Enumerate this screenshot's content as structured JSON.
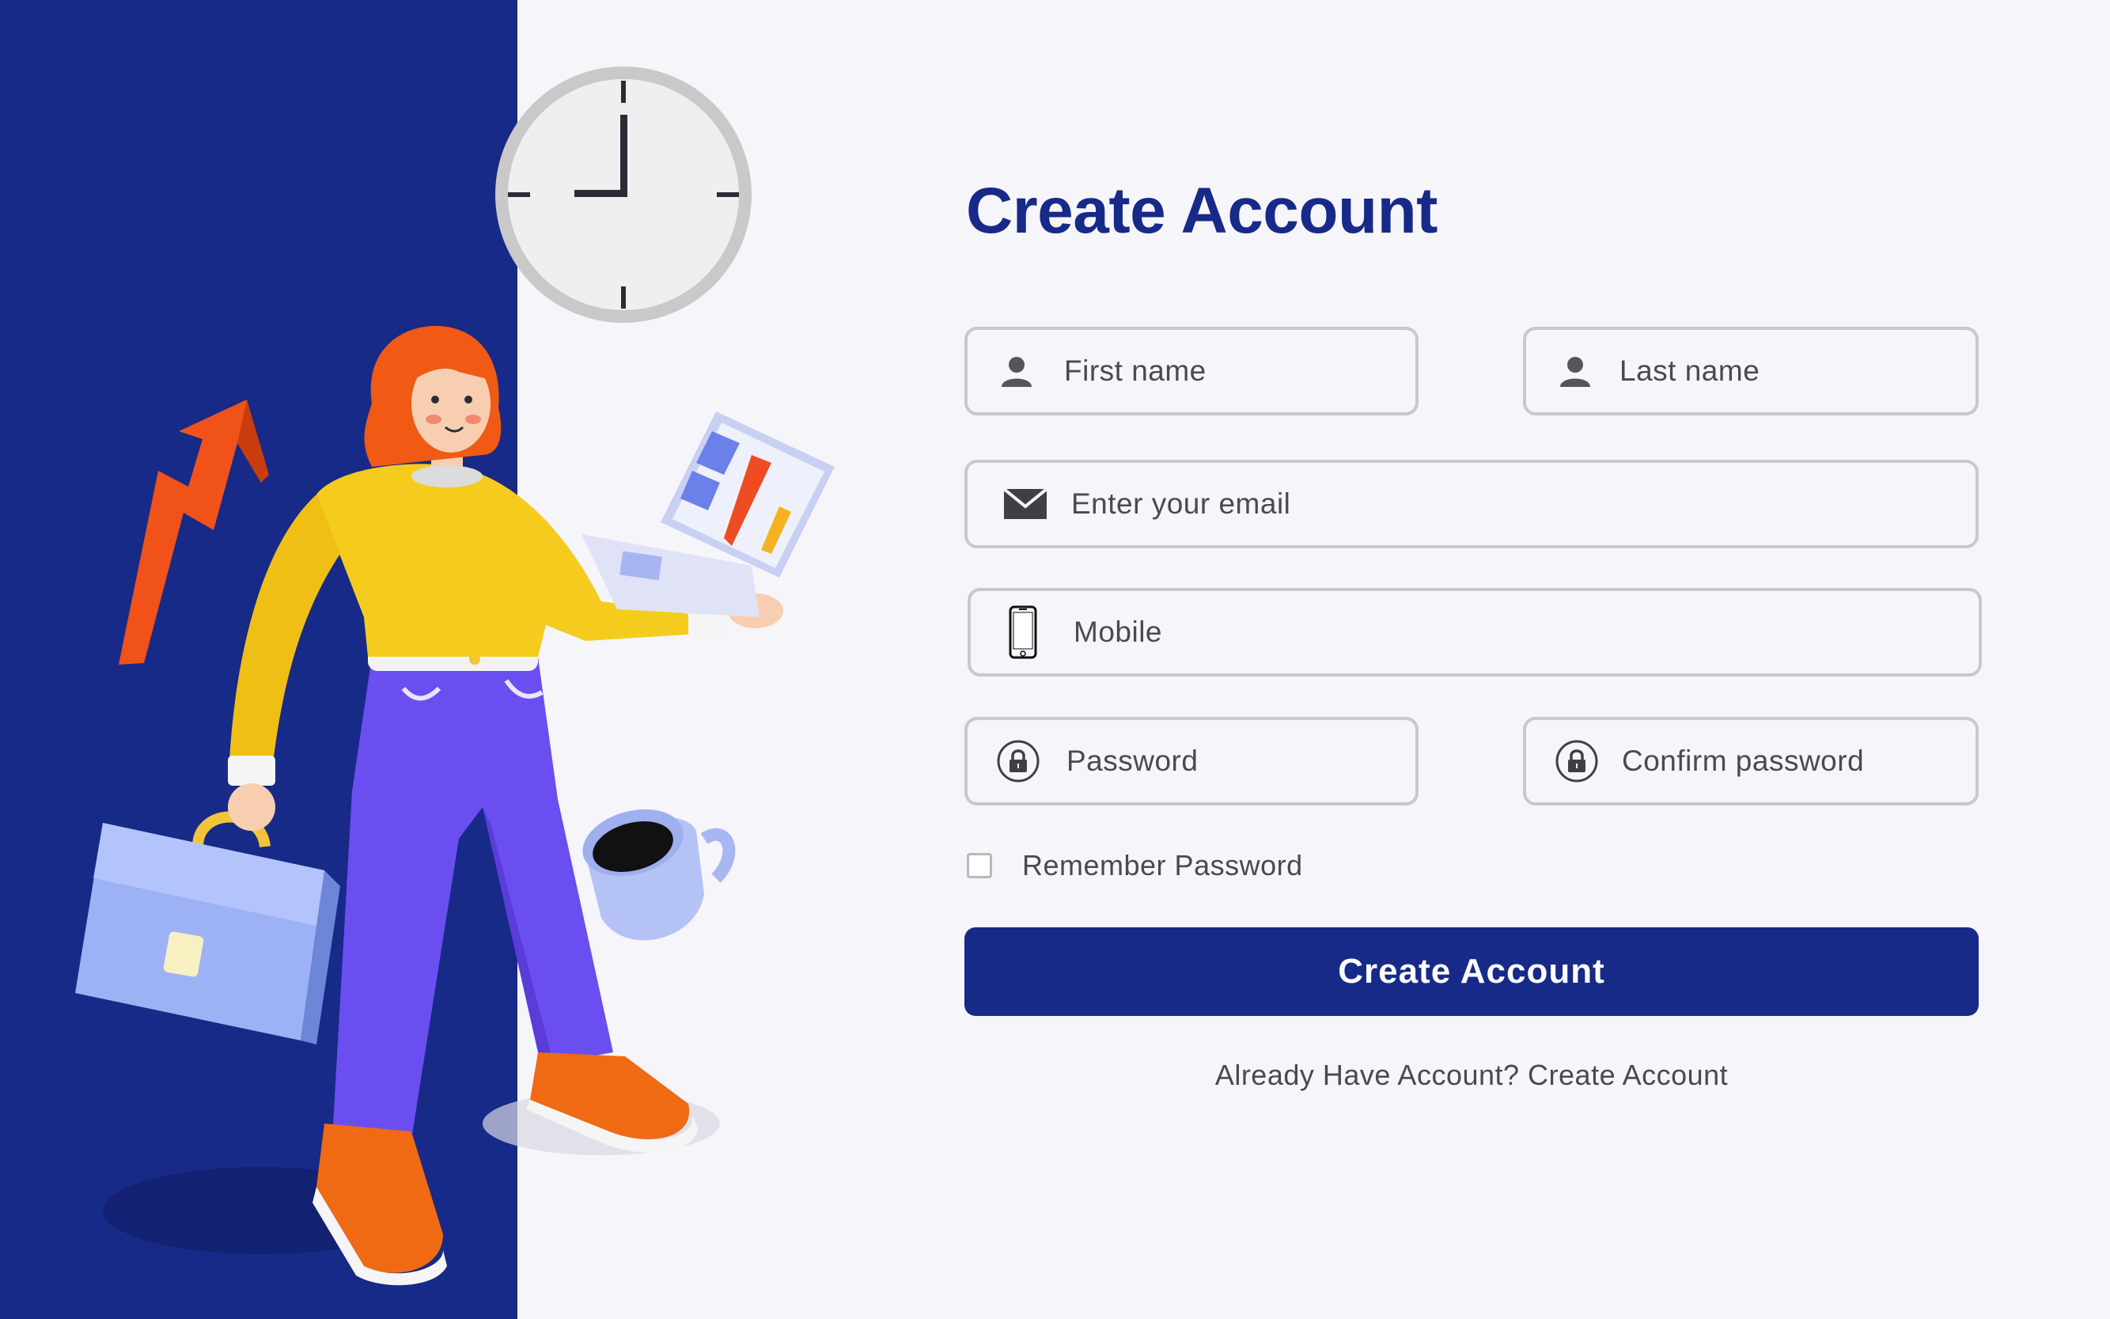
{
  "form": {
    "title": "Create Account",
    "first_name_placeholder": "First name",
    "last_name_placeholder": "Last name",
    "email_placeholder": "Enter your email",
    "mobile_placeholder": "Mobile",
    "password_placeholder": "Password",
    "confirm_password_placeholder": "Confirm password",
    "remember_label": "Remember Password",
    "remember_checked": false,
    "submit_label": "Create Account",
    "footer_text": "Already Have Account? Create Account"
  },
  "icons": {
    "first_name": "user-icon",
    "last_name": "user-icon",
    "email": "mail-icon",
    "mobile": "phone-icon",
    "password": "lock-icon",
    "confirm_password": "lock-icon"
  },
  "colors": {
    "brand": "#172a88",
    "background": "#f6f5fa",
    "field_border": "#c9c9cd",
    "text": "#4a4a4e"
  }
}
